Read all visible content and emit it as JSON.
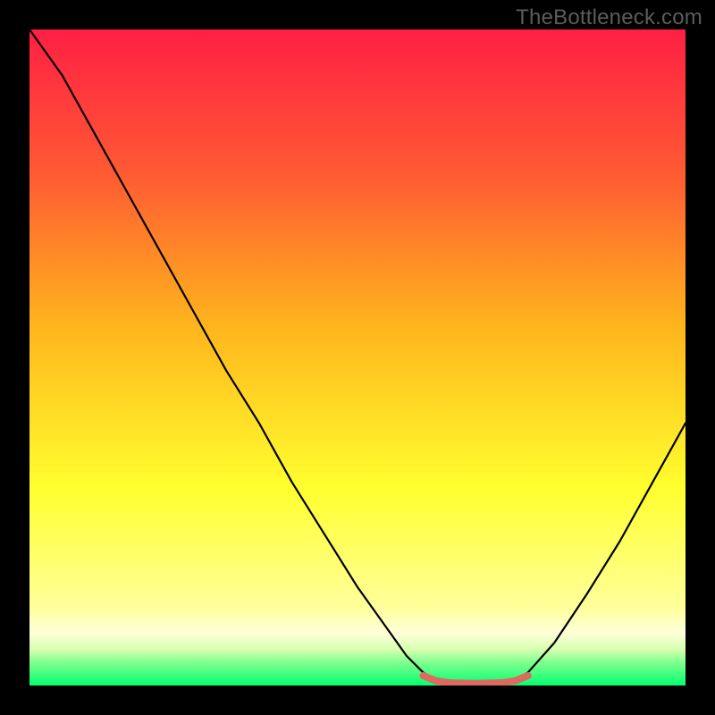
{
  "watermark": "TheBottleneck.com",
  "colors": {
    "frame": "#000000",
    "watermark": "#5c5c5c",
    "gradient_top": "#ff1f44",
    "gradient_mid_upper": "#ff6a2f",
    "gradient_mid": "#ffc219",
    "gradient_mid_lower": "#ffff35",
    "gradient_pale": "#ffffb0",
    "gradient_bottom": "#04ff70",
    "curve": "#000000",
    "valley_marker": "#dd6a61"
  },
  "chart_data": {
    "type": "line",
    "title": "",
    "xlabel": "",
    "ylabel": "",
    "xlim": [
      0,
      100
    ],
    "ylim": [
      0,
      100
    ],
    "grid": false,
    "curve": [
      {
        "x": 0.0,
        "y": 100.0
      },
      {
        "x": 5.0,
        "y": 93.0
      },
      {
        "x": 10.0,
        "y": 84.0
      },
      {
        "x": 15.0,
        "y": 75.0
      },
      {
        "x": 20.0,
        "y": 66.0
      },
      {
        "x": 25.0,
        "y": 57.0
      },
      {
        "x": 30.0,
        "y": 48.0
      },
      {
        "x": 35.0,
        "y": 40.0
      },
      {
        "x": 40.0,
        "y": 31.0
      },
      {
        "x": 45.0,
        "y": 23.0
      },
      {
        "x": 50.0,
        "y": 15.0
      },
      {
        "x": 55.0,
        "y": 8.0
      },
      {
        "x": 57.5,
        "y": 4.5
      },
      {
        "x": 60.0,
        "y": 2.0
      },
      {
        "x": 62.0,
        "y": 0.8
      },
      {
        "x": 64.0,
        "y": 0.4
      },
      {
        "x": 68.0,
        "y": 0.3
      },
      {
        "x": 72.0,
        "y": 0.4
      },
      {
        "x": 74.0,
        "y": 0.8
      },
      {
        "x": 76.0,
        "y": 2.0
      },
      {
        "x": 80.0,
        "y": 6.5
      },
      {
        "x": 85.0,
        "y": 14.0
      },
      {
        "x": 90.0,
        "y": 22.0
      },
      {
        "x": 95.0,
        "y": 31.0
      },
      {
        "x": 100.0,
        "y": 40.0
      }
    ],
    "valley_marker": [
      {
        "x": 60.0,
        "y": 1.5
      },
      {
        "x": 62.0,
        "y": 0.7
      },
      {
        "x": 64.0,
        "y": 0.4
      },
      {
        "x": 68.0,
        "y": 0.3
      },
      {
        "x": 72.0,
        "y": 0.4
      },
      {
        "x": 74.0,
        "y": 0.7
      },
      {
        "x": 76.0,
        "y": 1.5
      }
    ],
    "gradient_stops": [
      {
        "offset": 0.0,
        "color": "#ff1f44"
      },
      {
        "offset": 0.22,
        "color": "#ff5a33"
      },
      {
        "offset": 0.45,
        "color": "#ffb41c"
      },
      {
        "offset": 0.7,
        "color": "#ffff2e"
      },
      {
        "offset": 0.88,
        "color": "#ffff9a"
      },
      {
        "offset": 0.92,
        "color": "#feffd9"
      },
      {
        "offset": 0.945,
        "color": "#d7ffb0"
      },
      {
        "offset": 0.965,
        "color": "#7fff8e"
      },
      {
        "offset": 1.0,
        "color": "#04ff70"
      }
    ]
  }
}
